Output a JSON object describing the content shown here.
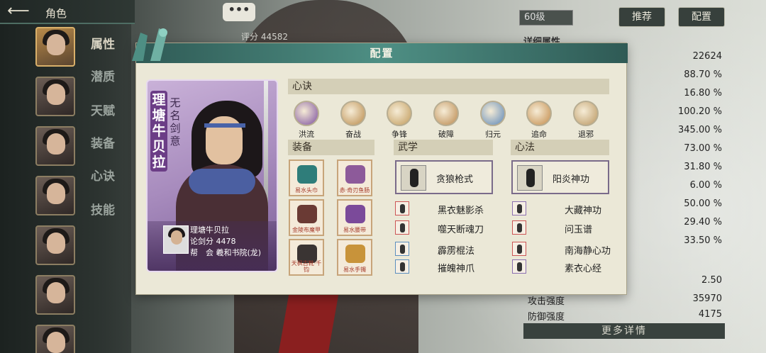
{
  "top": {
    "title": "角色",
    "chat": "•••",
    "score_label": "评分 44582"
  },
  "sidebar": {
    "menu": [
      "属性",
      "潜质",
      "天赋",
      "装备",
      "心诀",
      "技能"
    ]
  },
  "right_panel": {
    "level": "60级",
    "recommend": "推荐",
    "config": "配置",
    "detail_header": "详细属性",
    "values": [
      "22624",
      "88.70 %",
      "16.80 %",
      "100.20 %",
      "345.00 %",
      "73.00 %",
      "31.80 %",
      "6.00 %",
      "50.00 %",
      "29.40 %",
      "33.50 %"
    ],
    "bottom_stats": [
      {
        "label": "",
        "value": "2.50"
      },
      {
        "label": "攻击强度",
        "value": "35970"
      },
      {
        "label": "防御强度",
        "value": "4175"
      }
    ],
    "more": "更多详情"
  },
  "modal": {
    "title": "配置",
    "card": {
      "name_vertical": "理塘牛贝拉",
      "title_vertical": "无名剑意",
      "name": "理塘牛贝拉",
      "sword_score": "论剑分 4478",
      "guild": "帮　会 羲和书院(龙)"
    },
    "xinjue": {
      "label": "心诀",
      "skills": [
        {
          "name": "洪流",
          "color": "#7a4d9e"
        },
        {
          "name": "奋战",
          "color": "#b98a4a"
        },
        {
          "name": "争锋",
          "color": "#c09a5a"
        },
        {
          "name": "破障",
          "color": "#b9874c"
        },
        {
          "name": "归元",
          "color": "#5a86b8"
        },
        {
          "name": "追命",
          "color": "#c28a48"
        },
        {
          "name": "退邪",
          "color": "#b99660"
        }
      ]
    },
    "equipment": {
      "label": "装备",
      "items": [
        {
          "name": "易水头巾",
          "color": "#2f7d7a"
        },
        {
          "name": "赤·奇刃鱼肠",
          "color": "#8d5a9a"
        },
        {
          "name": "金陵布魔甲",
          "color": "#6a3a34"
        },
        {
          "name": "易水腰带",
          "color": "#7b4a9a"
        },
        {
          "name": "天枫古靴·千钧",
          "color": "#3a3433"
        },
        {
          "name": "易水手镯",
          "color": "#c8933a"
        }
      ]
    },
    "wuxue": {
      "label": "武学",
      "main": "贪狼枪式",
      "list": [
        "黑衣魅影杀",
        "噬天断魂刀",
        "霹雳棍法",
        "摧魄神爪"
      ]
    },
    "xinfa": {
      "label": "心法",
      "main": "阳炎神功",
      "list": [
        "大藏神功",
        "问玉谱",
        "南海静心功",
        "素衣心经"
      ]
    }
  }
}
